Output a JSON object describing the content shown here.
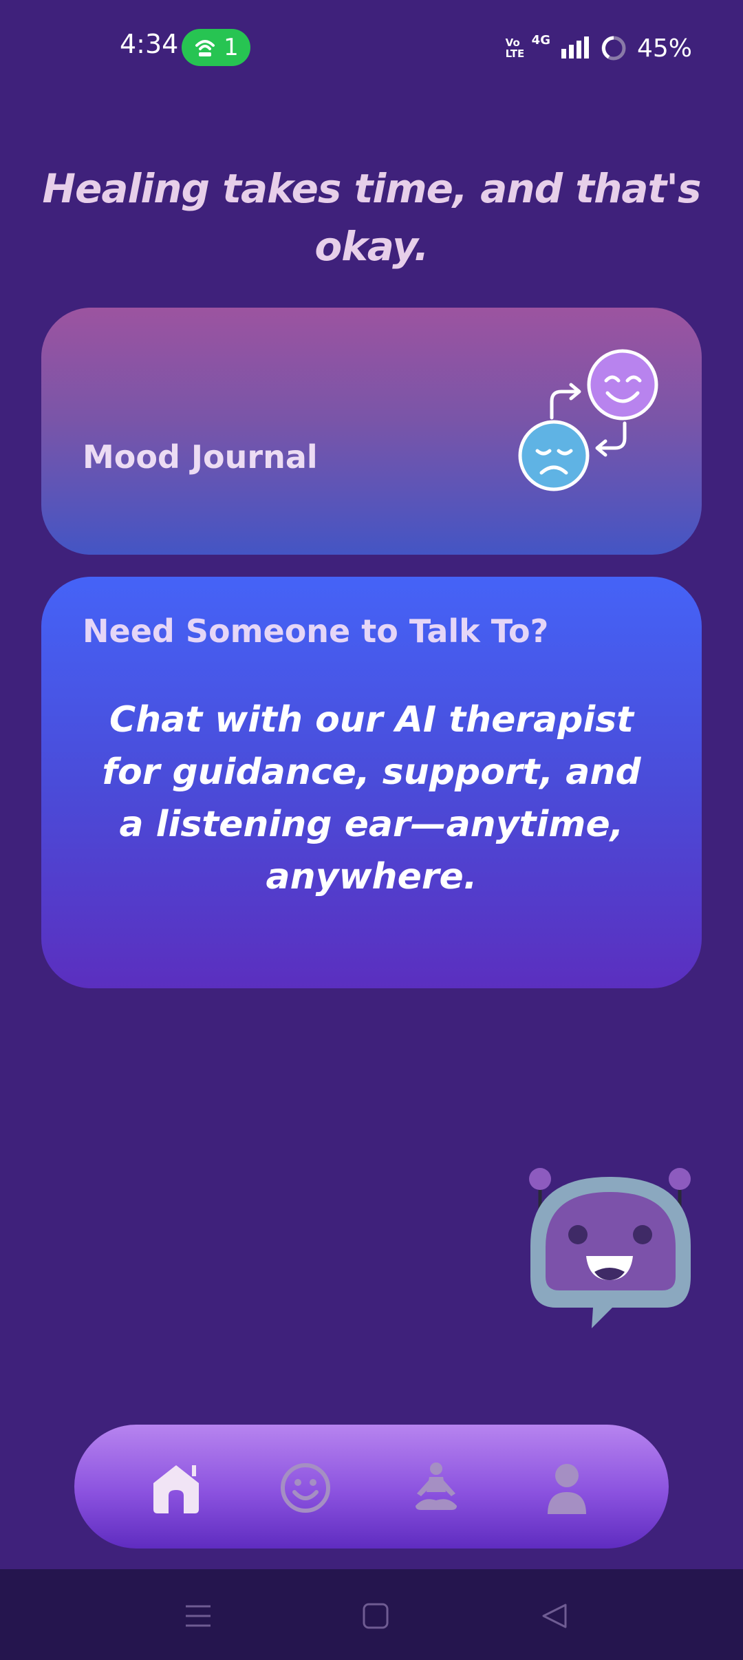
{
  "status_bar": {
    "time": "4:34",
    "hotspot_count": "1",
    "network": "4G",
    "volte": "Vo LTE",
    "battery": "45%"
  },
  "headline": "Healing takes time, and that's okay.",
  "mood_card": {
    "title": "Mood Journal",
    "icon": "mood-swap-icon"
  },
  "talk_card": {
    "title": "Need Someone to Talk To?",
    "body": "Chat with our AI therapist for guidance, support, and a listening ear—anytime, anywhere."
  },
  "bottom_nav": {
    "items": [
      {
        "icon": "home-icon",
        "active": true
      },
      {
        "icon": "smiley-icon",
        "active": false
      },
      {
        "icon": "meditation-icon",
        "active": false
      },
      {
        "icon": "profile-icon",
        "active": false
      }
    ]
  },
  "colors": {
    "background": "#3f217b",
    "headline": "#e7cfe9",
    "nav_active": "#f1e4f5",
    "nav_inactive": "#a58fc3"
  }
}
